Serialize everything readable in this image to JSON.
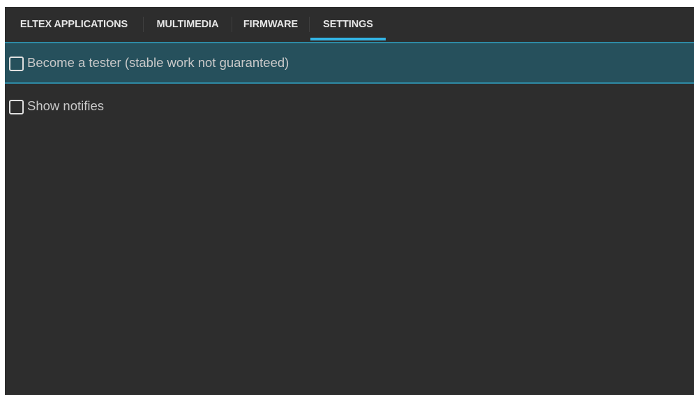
{
  "tabs": [
    {
      "label": "ELTEX APPLICATIONS",
      "active": false
    },
    {
      "label": "MULTIMEDIA",
      "active": false
    },
    {
      "label": "FIRMWARE",
      "active": false
    },
    {
      "label": "SETTINGS",
      "active": true
    }
  ],
  "settings": {
    "items": [
      {
        "label": "Become a tester (stable work not guaranteed)",
        "checked": false,
        "focused": true
      },
      {
        "label": "Show notifies",
        "checked": false,
        "focused": false
      }
    ]
  },
  "colors": {
    "background": "#2d2d2d",
    "accent": "#33b5e5",
    "focus_background": "#26505c",
    "focus_border": "#2e8aa4",
    "text": "#c9c9c9"
  },
  "icons": {
    "checkbox": "checkbox-unchecked-icon"
  }
}
